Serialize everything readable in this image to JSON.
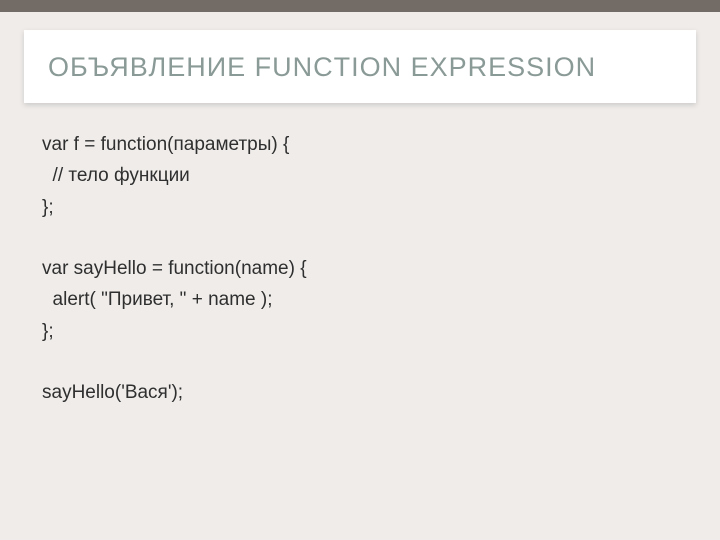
{
  "title": "ОБЪЯВЛЕНИЕ FUNCTION EXPRESSION",
  "code": {
    "l1": "var f = function(параметры) {",
    "l2": "  // тело функции",
    "l3": "};",
    "l4": "var sayHello = function(name) {",
    "l5": "  alert( \"Привет, \" + name );",
    "l6": "};",
    "l7": "sayHello('Вася');"
  }
}
